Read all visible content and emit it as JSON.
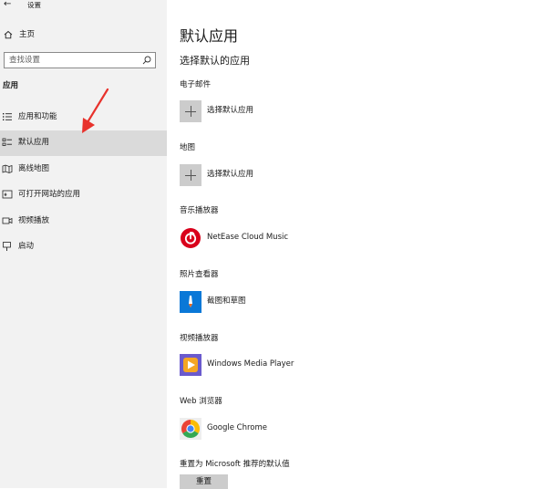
{
  "window": {
    "title": "设置"
  },
  "sidebar": {
    "home_label": "主页",
    "search": {
      "placeholder": "查找设置",
      "value": ""
    },
    "section_label": "应用",
    "items": [
      {
        "label": "应用和功能",
        "icon": "list-icon"
      },
      {
        "label": "默认应用",
        "icon": "default-apps-icon",
        "selected": true
      },
      {
        "label": "离线地图",
        "icon": "map-icon"
      },
      {
        "label": "可打开网站的应用",
        "icon": "website-apps-icon"
      },
      {
        "label": "视频播放",
        "icon": "video-icon"
      },
      {
        "label": "启动",
        "icon": "startup-icon"
      }
    ]
  },
  "main": {
    "title": "默认应用",
    "subtitle": "选择默认的应用",
    "categories": [
      {
        "label": "电子邮件",
        "app": "选择默认应用",
        "icon": "plus-icon"
      },
      {
        "label": "地图",
        "app": "选择默认应用",
        "icon": "plus-icon"
      },
      {
        "label": "音乐播放器",
        "app": "NetEase Cloud Music",
        "icon": "netease-music-icon"
      },
      {
        "label": "照片查看器",
        "app": "截图和草图",
        "icon": "snip-sketch-icon"
      },
      {
        "label": "视频播放器",
        "app": "Windows Media Player",
        "icon": "media-player-icon"
      },
      {
        "label": "Web 浏览器",
        "app": "Google Chrome",
        "icon": "chrome-icon"
      }
    ],
    "reset": {
      "label": "重置为 Microsoft 推荐的默认值",
      "button": "重置"
    }
  },
  "colors": {
    "sidebar_bg": "#f2f2f2",
    "selected_bg": "#dadada",
    "tile_bg": "#cccccc",
    "annotation_red": "#e8322c",
    "netease_red": "#d9001b",
    "snip_blue": "#0a78d7",
    "media_player_purple": "#6a5acd"
  }
}
